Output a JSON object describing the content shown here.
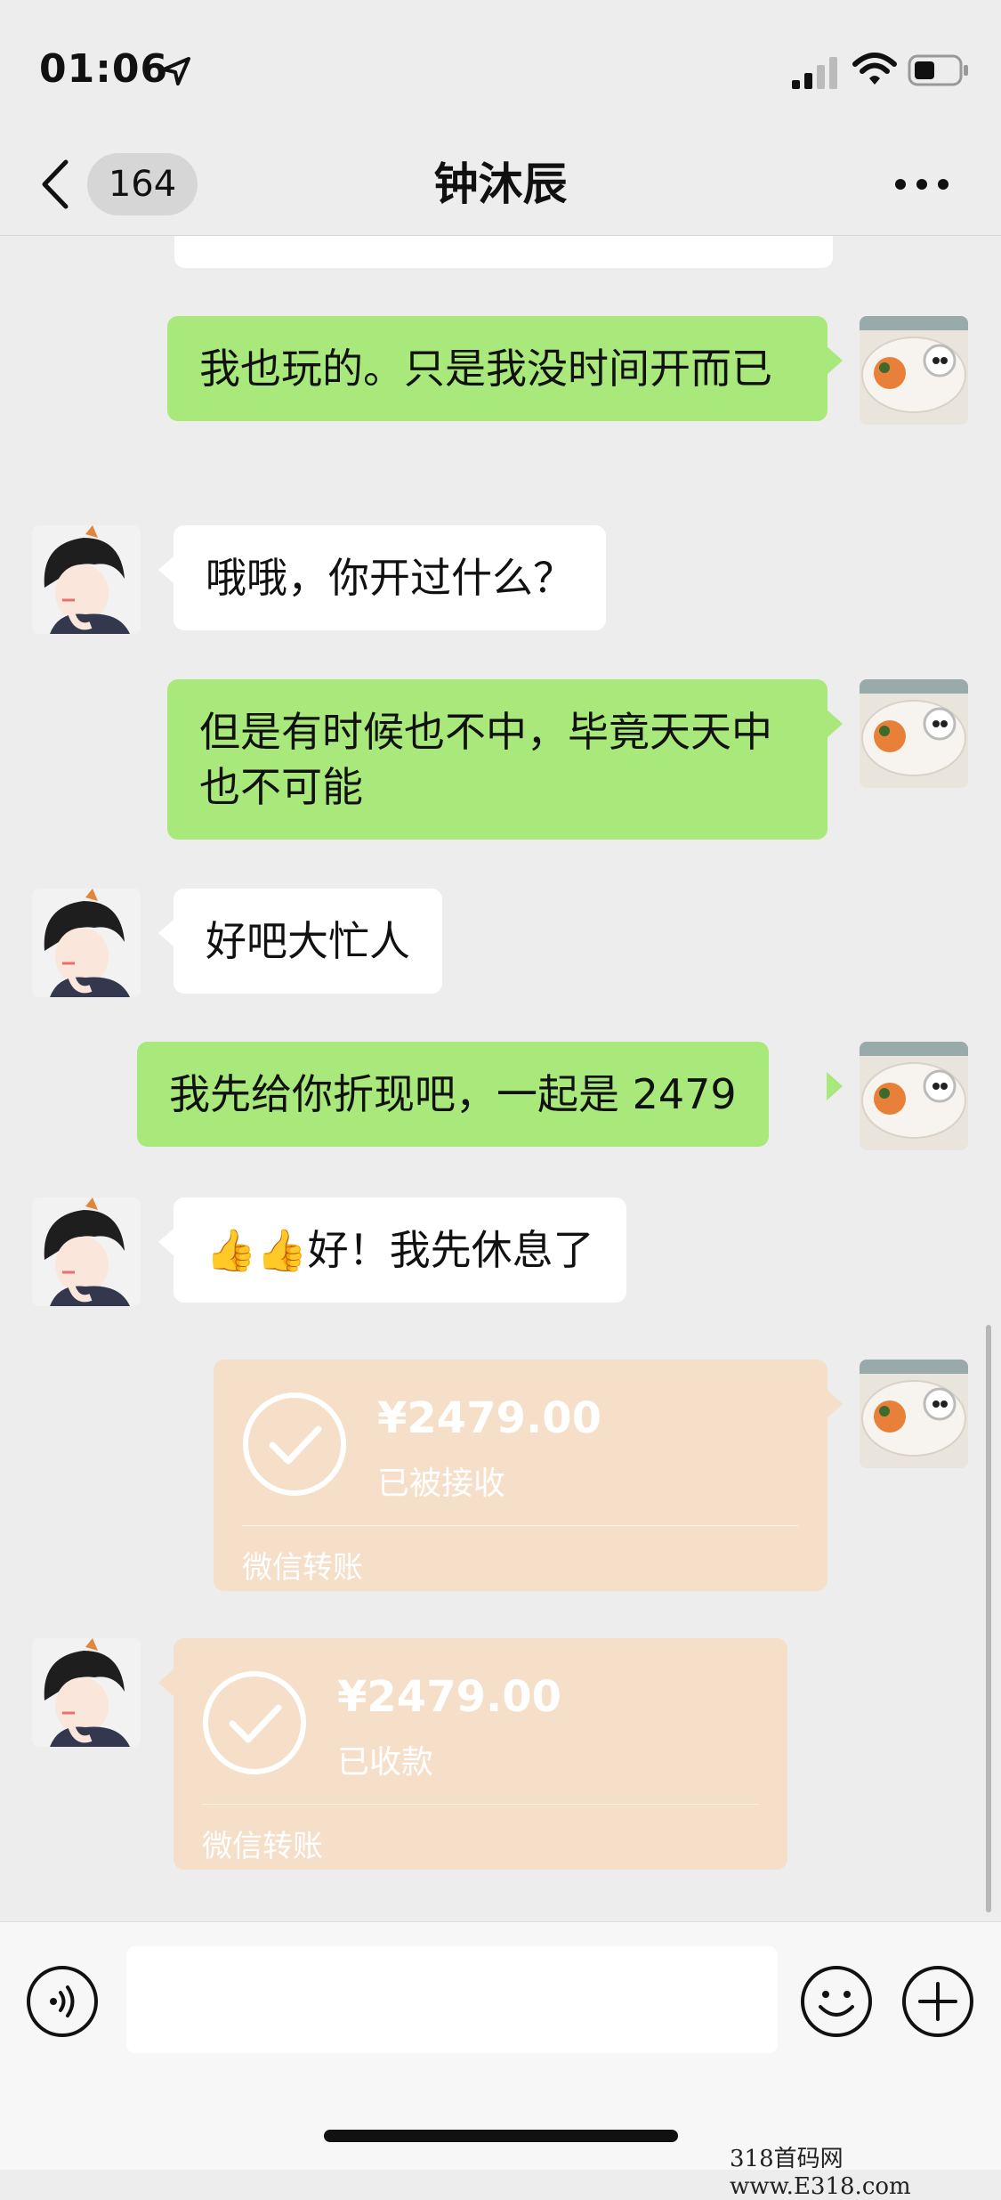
{
  "status_bar": {
    "time": "01:06"
  },
  "nav": {
    "unread_count": "164",
    "title": "钟沐辰"
  },
  "messages": [
    {
      "side": "right",
      "text": "我也玩的。只是我没时间开而已"
    },
    {
      "side": "left",
      "text": "哦哦，你开过什么？"
    },
    {
      "side": "right",
      "text": "但是有时候也不中，毕竟天天中也不可能"
    },
    {
      "side": "left",
      "text": "好吧大忙人"
    },
    {
      "side": "right",
      "text": "我先给你折现吧，一起是 2479"
    },
    {
      "side": "left",
      "emoji": "👍👍",
      "text": "好！我先休息了"
    }
  ],
  "transfers": [
    {
      "side": "right",
      "amount": "¥2479.00",
      "status": "已被接收",
      "source": "微信转账"
    },
    {
      "side": "left",
      "amount": "¥2479.00",
      "status": "已收款",
      "source": "微信转账"
    }
  ],
  "colors": {
    "background": "#ededed",
    "sent_bubble": "#a9e87a",
    "received_bubble": "#ffffff",
    "transfer_card": "#f6dfc8"
  },
  "watermark": "318首码网 www.E318.com"
}
